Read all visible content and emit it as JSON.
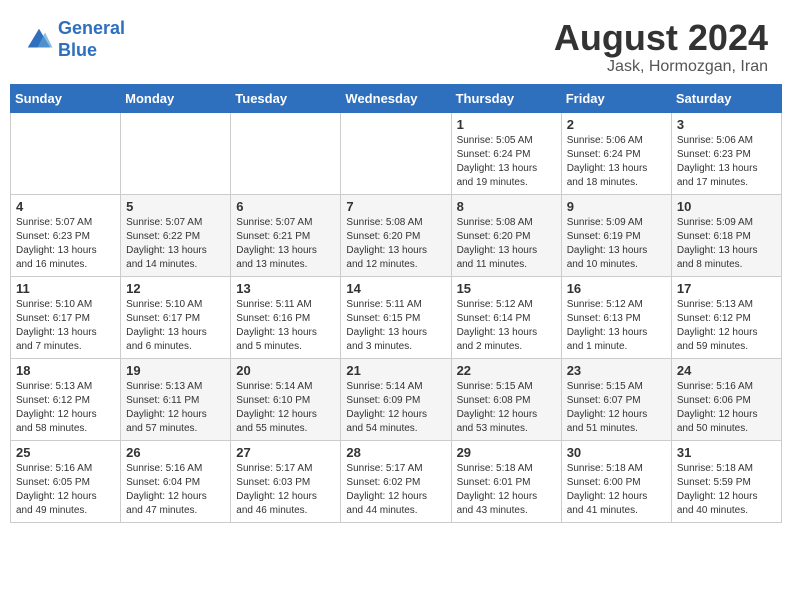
{
  "header": {
    "logo_line1": "General",
    "logo_line2": "Blue",
    "main_title": "August 2024",
    "subtitle": "Jask, Hormozgan, Iran"
  },
  "days_of_week": [
    "Sunday",
    "Monday",
    "Tuesday",
    "Wednesday",
    "Thursday",
    "Friday",
    "Saturday"
  ],
  "weeks": [
    [
      {
        "num": "",
        "info": ""
      },
      {
        "num": "",
        "info": ""
      },
      {
        "num": "",
        "info": ""
      },
      {
        "num": "",
        "info": ""
      },
      {
        "num": "1",
        "info": "Sunrise: 5:05 AM\nSunset: 6:24 PM\nDaylight: 13 hours\nand 19 minutes."
      },
      {
        "num": "2",
        "info": "Sunrise: 5:06 AM\nSunset: 6:24 PM\nDaylight: 13 hours\nand 18 minutes."
      },
      {
        "num": "3",
        "info": "Sunrise: 5:06 AM\nSunset: 6:23 PM\nDaylight: 13 hours\nand 17 minutes."
      }
    ],
    [
      {
        "num": "4",
        "info": "Sunrise: 5:07 AM\nSunset: 6:23 PM\nDaylight: 13 hours\nand 16 minutes."
      },
      {
        "num": "5",
        "info": "Sunrise: 5:07 AM\nSunset: 6:22 PM\nDaylight: 13 hours\nand 14 minutes."
      },
      {
        "num": "6",
        "info": "Sunrise: 5:07 AM\nSunset: 6:21 PM\nDaylight: 13 hours\nand 13 minutes."
      },
      {
        "num": "7",
        "info": "Sunrise: 5:08 AM\nSunset: 6:20 PM\nDaylight: 13 hours\nand 12 minutes."
      },
      {
        "num": "8",
        "info": "Sunrise: 5:08 AM\nSunset: 6:20 PM\nDaylight: 13 hours\nand 11 minutes."
      },
      {
        "num": "9",
        "info": "Sunrise: 5:09 AM\nSunset: 6:19 PM\nDaylight: 13 hours\nand 10 minutes."
      },
      {
        "num": "10",
        "info": "Sunrise: 5:09 AM\nSunset: 6:18 PM\nDaylight: 13 hours\nand 8 minutes."
      }
    ],
    [
      {
        "num": "11",
        "info": "Sunrise: 5:10 AM\nSunset: 6:17 PM\nDaylight: 13 hours\nand 7 minutes."
      },
      {
        "num": "12",
        "info": "Sunrise: 5:10 AM\nSunset: 6:17 PM\nDaylight: 13 hours\nand 6 minutes."
      },
      {
        "num": "13",
        "info": "Sunrise: 5:11 AM\nSunset: 6:16 PM\nDaylight: 13 hours\nand 5 minutes."
      },
      {
        "num": "14",
        "info": "Sunrise: 5:11 AM\nSunset: 6:15 PM\nDaylight: 13 hours\nand 3 minutes."
      },
      {
        "num": "15",
        "info": "Sunrise: 5:12 AM\nSunset: 6:14 PM\nDaylight: 13 hours\nand 2 minutes."
      },
      {
        "num": "16",
        "info": "Sunrise: 5:12 AM\nSunset: 6:13 PM\nDaylight: 13 hours\nand 1 minute."
      },
      {
        "num": "17",
        "info": "Sunrise: 5:13 AM\nSunset: 6:12 PM\nDaylight: 12 hours\nand 59 minutes."
      }
    ],
    [
      {
        "num": "18",
        "info": "Sunrise: 5:13 AM\nSunset: 6:12 PM\nDaylight: 12 hours\nand 58 minutes."
      },
      {
        "num": "19",
        "info": "Sunrise: 5:13 AM\nSunset: 6:11 PM\nDaylight: 12 hours\nand 57 minutes."
      },
      {
        "num": "20",
        "info": "Sunrise: 5:14 AM\nSunset: 6:10 PM\nDaylight: 12 hours\nand 55 minutes."
      },
      {
        "num": "21",
        "info": "Sunrise: 5:14 AM\nSunset: 6:09 PM\nDaylight: 12 hours\nand 54 minutes."
      },
      {
        "num": "22",
        "info": "Sunrise: 5:15 AM\nSunset: 6:08 PM\nDaylight: 12 hours\nand 53 minutes."
      },
      {
        "num": "23",
        "info": "Sunrise: 5:15 AM\nSunset: 6:07 PM\nDaylight: 12 hours\nand 51 minutes."
      },
      {
        "num": "24",
        "info": "Sunrise: 5:16 AM\nSunset: 6:06 PM\nDaylight: 12 hours\nand 50 minutes."
      }
    ],
    [
      {
        "num": "25",
        "info": "Sunrise: 5:16 AM\nSunset: 6:05 PM\nDaylight: 12 hours\nand 49 minutes."
      },
      {
        "num": "26",
        "info": "Sunrise: 5:16 AM\nSunset: 6:04 PM\nDaylight: 12 hours\nand 47 minutes."
      },
      {
        "num": "27",
        "info": "Sunrise: 5:17 AM\nSunset: 6:03 PM\nDaylight: 12 hours\nand 46 minutes."
      },
      {
        "num": "28",
        "info": "Sunrise: 5:17 AM\nSunset: 6:02 PM\nDaylight: 12 hours\nand 44 minutes."
      },
      {
        "num": "29",
        "info": "Sunrise: 5:18 AM\nSunset: 6:01 PM\nDaylight: 12 hours\nand 43 minutes."
      },
      {
        "num": "30",
        "info": "Sunrise: 5:18 AM\nSunset: 6:00 PM\nDaylight: 12 hours\nand 41 minutes."
      },
      {
        "num": "31",
        "info": "Sunrise: 5:18 AM\nSunset: 5:59 PM\nDaylight: 12 hours\nand 40 minutes."
      }
    ]
  ]
}
